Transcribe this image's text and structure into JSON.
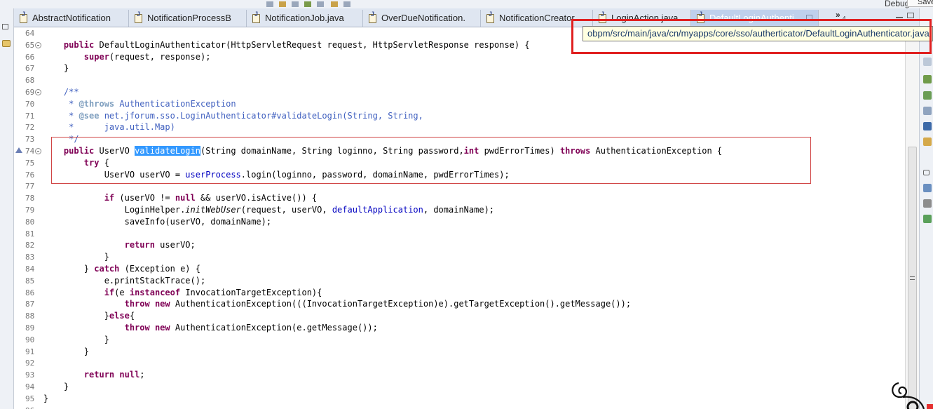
{
  "toolbar": {
    "debug_label": "Debug",
    "save_label": "Save"
  },
  "tabs": [
    {
      "label": "AbstractNotification",
      "active": false
    },
    {
      "label": "NotificationProcessB",
      "active": false
    },
    {
      "label": "NotificationJob.java",
      "active": false
    },
    {
      "label": "OverDueNotification.",
      "active": false
    },
    {
      "label": "NotificationCreator",
      "active": false
    },
    {
      "label": "LoginAction.java",
      "active": false
    },
    {
      "label": "DefaultLoginAuthenti",
      "active": true
    }
  ],
  "tab_overflow": {
    "symbol": "»",
    "count": "4"
  },
  "tooltip": {
    "path": "obpm/src/main/java/cn/myapps/core/sso/autherticator/DefaultLoginAuthenticator.java"
  },
  "code_lines": [
    {
      "n": "64",
      "html": ""
    },
    {
      "n": "65",
      "fold": true,
      "html": "    <span class='kw'>public</span> DefaultLoginAuthenticator(HttpServletRequest request, HttpServletResponse response) {"
    },
    {
      "n": "66",
      "html": "        <span class='kw'>super</span>(request, response);"
    },
    {
      "n": "67",
      "html": "    }"
    },
    {
      "n": "68",
      "html": ""
    },
    {
      "n": "69",
      "fold": true,
      "html": "    <span class='cm'>/**</span>"
    },
    {
      "n": "70",
      "html": "<span class='cm'>     * <span class='tag'>@throws</span> AuthenticationException</span>"
    },
    {
      "n": "71",
      "html": "<span class='cm'>     * <span class='tag'>@see</span> net.jforum.sso.LoginAuthenticator#validateLogin(String, String,</span>"
    },
    {
      "n": "72",
      "html": "<span class='cm'>     *      java.util.Map)</span>"
    },
    {
      "n": "73",
      "html": "<span class='cm'>     */</span>"
    },
    {
      "n": "74",
      "fold": true,
      "override": true,
      "html": "    <span class='kw'>public</span> UserVO <span class='sel'>validateLogin</span>(String domainName, String loginno, String password,<span class='kw'>int</span> pwdErrorTimes) <span class='kw'>throws</span> AuthenticationException {"
    },
    {
      "n": "75",
      "html": "        <span class='kw'>try</span> {"
    },
    {
      "n": "76",
      "html": "            UserVO userVO = <span class='fld'>userProcess</span>.login(loginno, password, domainName, pwdErrorTimes);"
    },
    {
      "n": "77",
      "html": ""
    },
    {
      "n": "78",
      "html": "            <span class='kw'>if</span> (userVO != <span class='kw'>null</span> &amp;&amp; userVO.isActive()) {"
    },
    {
      "n": "79",
      "html": "                LoginHelper.<span class='it'>initWebUser</span>(request, userVO, <span class='fld'>defaultApplication</span>, domainName);"
    },
    {
      "n": "80",
      "html": "                saveInfo(userVO, domainName);"
    },
    {
      "n": "81",
      "html": ""
    },
    {
      "n": "82",
      "html": "                <span class='kw'>return</span> userVO;"
    },
    {
      "n": "83",
      "html": "            }"
    },
    {
      "n": "84",
      "html": "        } <span class='kw'>catch</span> (Exception e) {"
    },
    {
      "n": "85",
      "html": "            e.printStackTrace();"
    },
    {
      "n": "86",
      "html": "            <span class='kw'>if</span>(e <span class='kw'>instanceof</span> InvocationTargetException){"
    },
    {
      "n": "87",
      "html": "                <span class='kw'>throw</span> <span class='kw'>new</span> AuthenticationException(((InvocationTargetException)e).getTargetException().getMessage());"
    },
    {
      "n": "88",
      "html": "            }<span class='kw'>else</span>{"
    },
    {
      "n": "89",
      "html": "                <span class='kw'>throw</span> <span class='kw'>new</span> AuthenticationException(e.getMessage());"
    },
    {
      "n": "90",
      "html": "            }"
    },
    {
      "n": "91",
      "html": "        }"
    },
    {
      "n": "92",
      "html": ""
    },
    {
      "n": "93",
      "html": "        <span class='kw'>return</span> <span class='kw'>null</span>;"
    },
    {
      "n": "94",
      "html": "    }"
    },
    {
      "n": "95",
      "html": "}"
    },
    {
      "n": "96",
      "html": ""
    }
  ],
  "colors": {
    "keyword": "#7f0055",
    "comment": "#3f5fbf",
    "field": "#0000c0",
    "selection": "#3399ff",
    "annotation_red": "#e02020"
  }
}
